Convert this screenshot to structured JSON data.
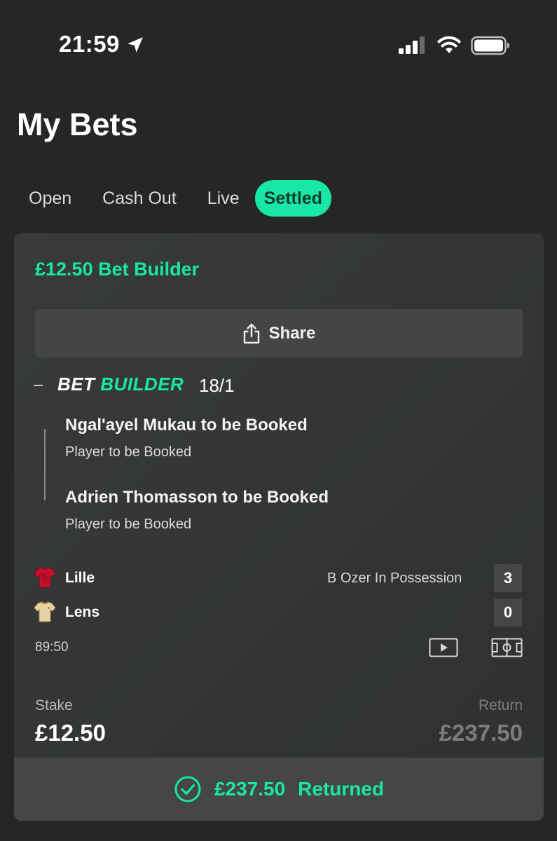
{
  "status_bar": {
    "time": "21:59"
  },
  "page": {
    "title": "My Bets"
  },
  "tabs": [
    {
      "label": "Open",
      "active": false
    },
    {
      "label": "Cash Out",
      "active": false
    },
    {
      "label": "Live",
      "active": false
    },
    {
      "label": "Settled",
      "active": true
    }
  ],
  "bet": {
    "title": "£12.50 Bet Builder",
    "share_label": "Share",
    "builder_word1": "BET",
    "builder_word2": "BUILDER",
    "odds": "18/1",
    "legs": [
      {
        "title": "Ngal'ayel Mukau to be Booked",
        "market": "Player to be Booked"
      },
      {
        "title": "Adrien Thomasson to be Booked",
        "market": "Player to be Booked"
      }
    ],
    "match": {
      "home": {
        "name": "Lille",
        "score": "3"
      },
      "away": {
        "name": "Lens",
        "score": "0"
      },
      "possession": "B Ozer In Possession",
      "clock": "89:50"
    },
    "stake_label": "Stake",
    "stake_value": "£12.50",
    "return_label": "Return",
    "return_value": "£237.50",
    "returned_amount": "£237.50",
    "returned_label": "Returned"
  },
  "colors": {
    "accent": "#18e7a5",
    "background": "#262626",
    "card": "#353837",
    "lille_shirt": "#c8102e",
    "lens_shirt": "#e8d3a5"
  },
  "icons": [
    "location-arrow-icon",
    "signal-icon",
    "wifi-icon",
    "battery-icon",
    "share-icon",
    "collapse-icon",
    "lille-shirt-icon",
    "lens-shirt-icon",
    "video-icon",
    "pitch-icon",
    "check-circle-icon"
  ]
}
